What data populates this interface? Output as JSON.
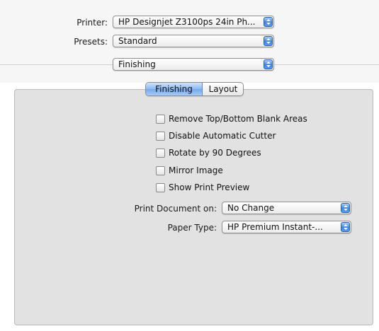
{
  "printer": {
    "label": "Printer:",
    "value": "HP Designjet Z3100ps 24in Ph..."
  },
  "presets": {
    "label": "Presets:",
    "value": "Standard"
  },
  "pane_menu": {
    "value": "Finishing"
  },
  "tabs": [
    {
      "label": "Finishing",
      "selected": true
    },
    {
      "label": "Layout",
      "selected": false
    }
  ],
  "options": [
    {
      "label": "Remove Top/Bottom Blank Areas",
      "checked": false
    },
    {
      "label": "Disable Automatic Cutter",
      "checked": false
    },
    {
      "label": "Rotate by 90 Degrees",
      "checked": false
    },
    {
      "label": "Mirror Image",
      "checked": false
    },
    {
      "label": "Show Print Preview",
      "checked": false
    }
  ],
  "print_document_on": {
    "label": "Print Document on:",
    "value": "No Change"
  },
  "paper_type": {
    "label": "Paper Type:",
    "value": "HP Premium Instant-..."
  },
  "colors": {
    "accent": "#4a8ee6",
    "panel": "#e2e2e2"
  }
}
